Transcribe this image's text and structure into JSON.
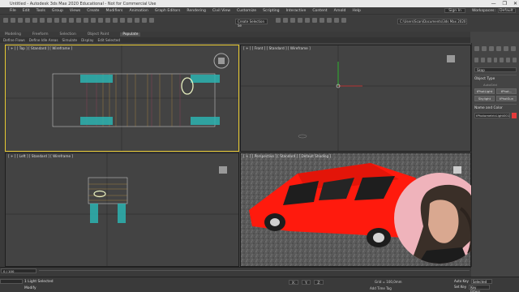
{
  "window": {
    "title": "Untitled - Autodesk 3ds Max 2020 Educational - Not for Commercial Use",
    "controls": [
      "—",
      "❐",
      "✕"
    ]
  },
  "menu": {
    "items": [
      "File",
      "Edit",
      "Tools",
      "Group",
      "Views",
      "Create",
      "Modifiers",
      "Animation",
      "Graph Editors",
      "Rendering",
      "Civil View",
      "Customize",
      "Scripting",
      "Interactive",
      "Content",
      "Arnold",
      "Help"
    ],
    "sign_in": "Sign In",
    "workspaces_label": "Workspaces:",
    "workspaces_value": "Default"
  },
  "toolbar": {
    "selection_set": "Create Selection Se",
    "project_path": "C:\\Users\\Scan\\Documents\\3ds Max 2020"
  },
  "ribbon": {
    "tabs": [
      "Modeling",
      "Freeform",
      "Selection",
      "Object Paint",
      "Populate"
    ],
    "active_tab": "Populate",
    "sub": [
      "Define Flows",
      "Define Idle Areas",
      "Simulate",
      "Display",
      "Edit Selected"
    ]
  },
  "viewports": {
    "top": "[ + ] [ Top ] [ Standard ] [ Wireframe ]",
    "front": "[ + ] [ Front ] [ Standard ] [ Wireframe ]",
    "left": "[ + ] [ Left ] [ Standard ] [ Wireframe ]",
    "perspective": "[ + ] [ Perspective ] [ Standard ] [ Default Shading ]"
  },
  "command_panel": {
    "field": "Skap",
    "object_type_title": "Object Type",
    "autogrid": "AutoGrid",
    "buttons": [
      [
        "tPhotLight",
        "tPhot..."
      ],
      [
        "Skylight",
        "tPhotSun"
      ]
    ],
    "name_color_title": "Name and Color",
    "name_value": "tPhotometricLight001",
    "swatch_color": "#e43b3b"
  },
  "timeline": {
    "frame_counter": "0 / 100"
  },
  "status": {
    "line1": "1 Light Selected",
    "line2": "Modify",
    "coords": [
      "X:",
      "Y:",
      "Z:"
    ],
    "grid": "Grid = 100,0mm",
    "add_time_tag": "Add Time Tag",
    "auto_key": "Auto Key",
    "auto_key_mode": "Selected",
    "set_key": "Set Key",
    "key_filters": "Key Filters..."
  }
}
